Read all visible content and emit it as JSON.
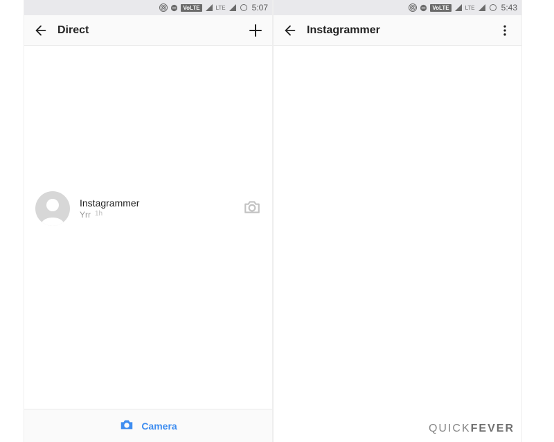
{
  "left": {
    "status": {
      "time": "5:07",
      "badge": "VoLTE",
      "sig2": "LTE"
    },
    "header": {
      "title": "Direct"
    },
    "conversation": {
      "name": "Instagrammer",
      "preview": "Yrr",
      "time": "1h"
    },
    "bottom": {
      "label": "Camera"
    }
  },
  "right": {
    "status": {
      "time": "5:43",
      "badge": "VoLTE",
      "sig2": "LTE"
    },
    "header": {
      "title": "Instagrammer"
    }
  },
  "watermark": {
    "thin": "QUICK",
    "bold": "FEVER"
  }
}
